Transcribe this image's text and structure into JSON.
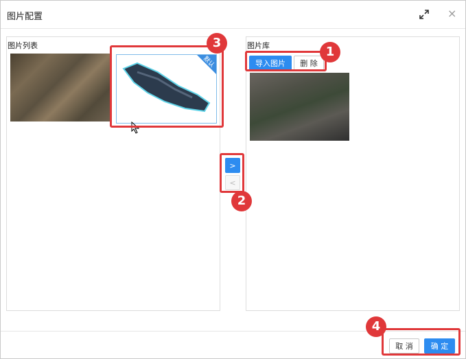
{
  "dialog": {
    "title": "图片配置",
    "close_symbol": "×"
  },
  "left_panel": {
    "title": "图片列表",
    "selected_badge": "默认"
  },
  "right_panel": {
    "title": "图片库",
    "import_label": "导入图片",
    "delete_label": "删 除"
  },
  "transfer": {
    "to_right": ">",
    "to_left": "<"
  },
  "footer": {
    "cancel_label": "取 消",
    "ok_label": "确 定"
  },
  "callouts": [
    "1",
    "2",
    "3",
    "4"
  ],
  "icons": [
    "maximize-icon",
    "close-icon",
    "cursor-icon"
  ],
  "colors": {
    "primary": "#2d8cf0",
    "callout": "#e0383a"
  }
}
